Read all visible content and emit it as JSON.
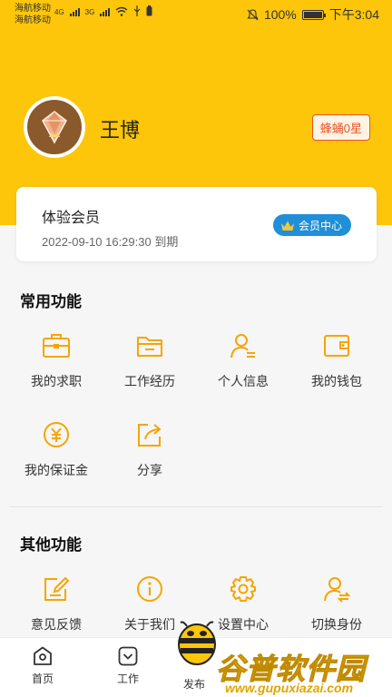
{
  "status_bar": {
    "carrier1": "海航移动",
    "carrier2": "海航移动",
    "net1": "4G",
    "net2": "3G",
    "battery_pct": "100%",
    "time": "下午3:04",
    "battery_level": 1.0
  },
  "profile": {
    "name": "王博",
    "level": "蜂蛹0星"
  },
  "member": {
    "title": "体验会员",
    "expire": "2022-09-10 16:29:30 到期",
    "center_button": "会员中心"
  },
  "common": {
    "title": "常用功能",
    "items": [
      {
        "label": "我的求职",
        "icon": "briefcase-icon"
      },
      {
        "label": "工作经历",
        "icon": "folder-icon"
      },
      {
        "label": "个人信息",
        "icon": "person-icon"
      },
      {
        "label": "我的钱包",
        "icon": "wallet-icon"
      },
      {
        "label": "我的保证金",
        "icon": "deposit-icon"
      },
      {
        "label": "分享",
        "icon": "share-icon"
      }
    ]
  },
  "other": {
    "title": "其他功能",
    "items": [
      {
        "label": "意见反馈",
        "icon": "feedback-icon"
      },
      {
        "label": "关于我们",
        "icon": "info-icon"
      },
      {
        "label": "设置中心",
        "icon": "gear-icon"
      },
      {
        "label": "切换身份",
        "icon": "switch-user-icon"
      }
    ]
  },
  "tabs": {
    "home": "首页",
    "work": "工作",
    "publish": "发布"
  },
  "watermark": {
    "text": "谷普软件园",
    "url": "www.gupuxiazai.com"
  },
  "colors": {
    "brand_yellow": "#fdc60a",
    "accent_blue": "#1f8fd8",
    "badge_red": "#e8552b",
    "icon_orange": "#f5a500"
  }
}
